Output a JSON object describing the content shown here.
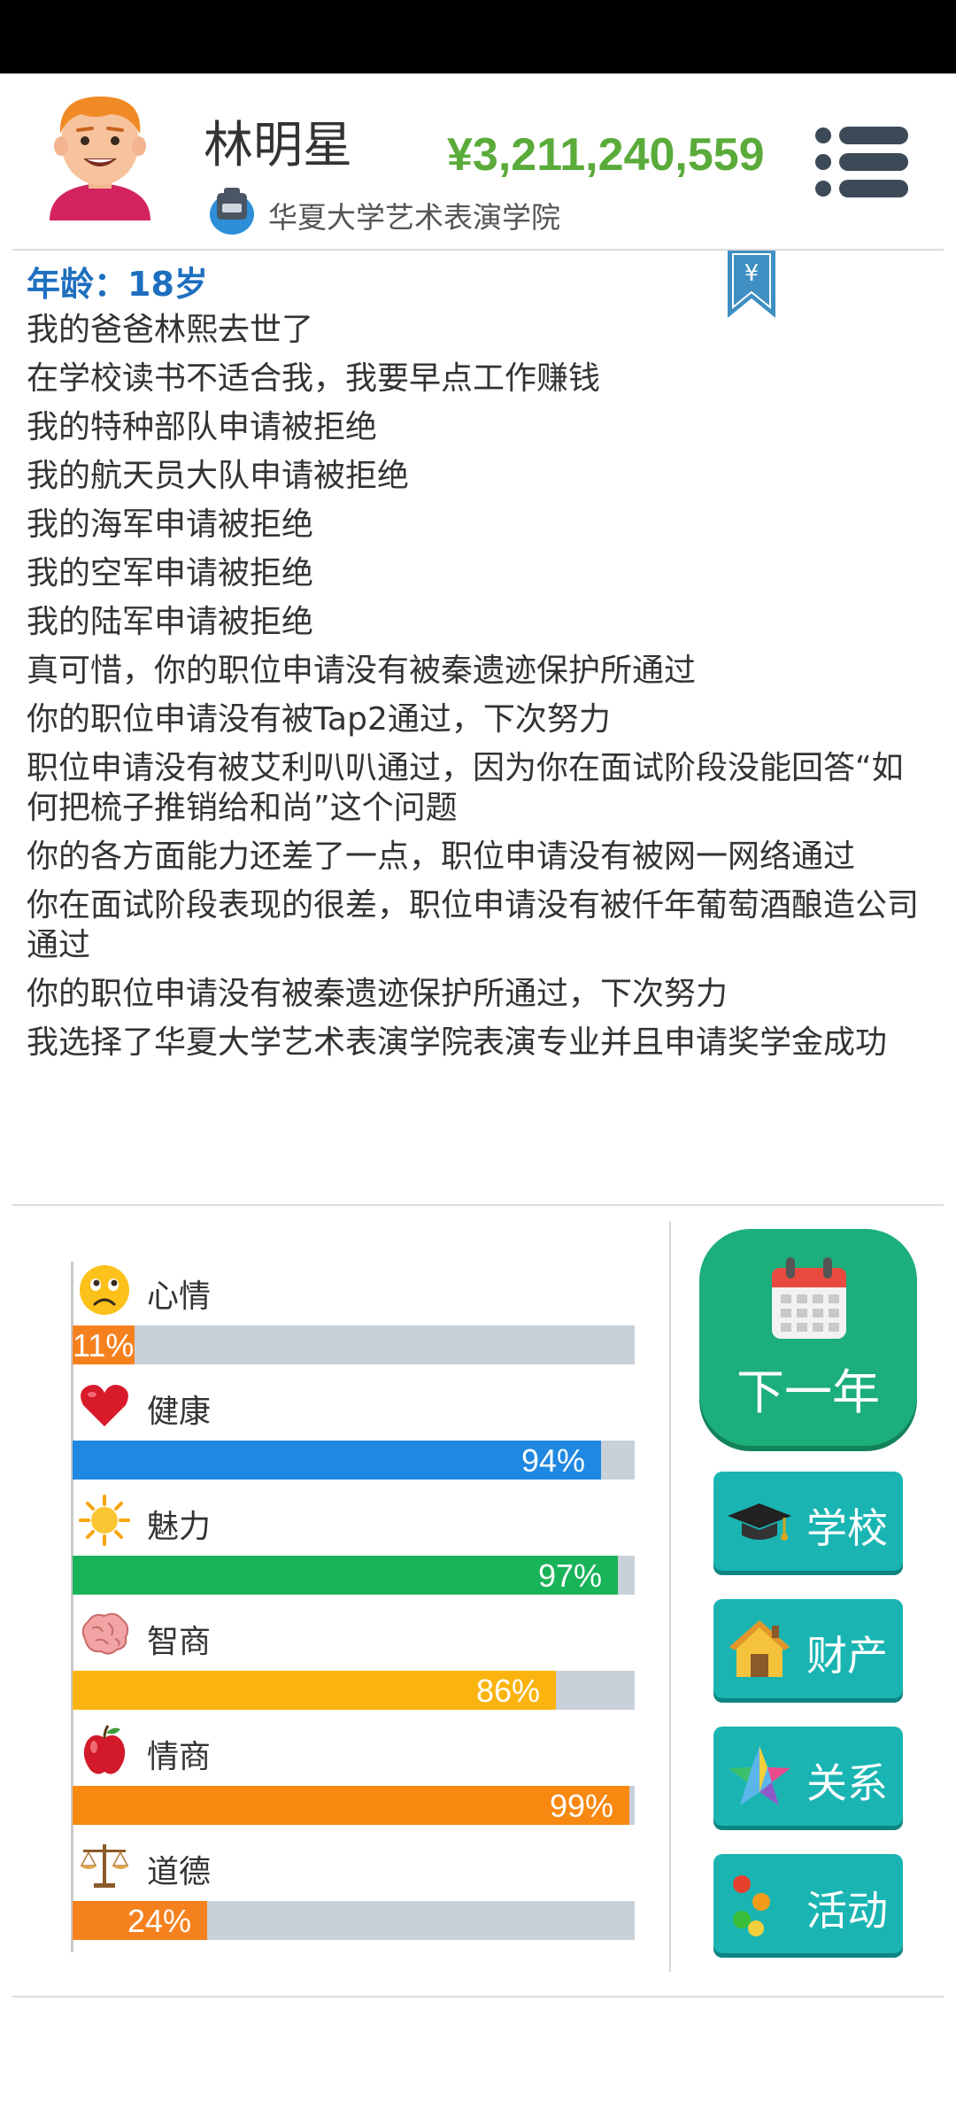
{
  "profile": {
    "name": "林明星",
    "money": "¥3,211,240,559",
    "school": "华夏大学艺术表演学院"
  },
  "log": {
    "age_line": "年龄：18岁",
    "bookmark_symbol": "¥",
    "entries": [
      "我的爸爸林熙去世了",
      "在学校读书不适合我，我要早点工作赚钱",
      "我的特种部队申请被拒绝",
      "我的航天员大队申请被拒绝",
      "我的海军申请被拒绝",
      "我的空军申请被拒绝",
      "我的陆军申请被拒绝",
      "真可惜，你的职位申请没有被秦遗迹保护所通过",
      "你的职位申请没有被Tap2通过，下次努力",
      "职位申请没有被艾利叭叭通过，因为你在面试阶段没能回答“如何把梳子推销给和尚”这个问题",
      "你的各方面能力还差了一点，职位申请没有被网一网络通过",
      "你在面试阶段表现的很差，职位申请没有被仟年葡萄酒酿造公司通过",
      "你的职位申请没有被秦遗迹保护所通过，下次努力",
      "我选择了华夏大学艺术表演学院表演专业并且申请奖学金成功"
    ]
  },
  "stats": [
    {
      "key": "mood",
      "label": "心情",
      "value": 11,
      "display": "11%",
      "color": "#f5811e",
      "icon": "sad-face-icon"
    },
    {
      "key": "health",
      "label": "健康",
      "value": 94,
      "display": "94%",
      "color": "#1f88e0",
      "icon": "heart-icon"
    },
    {
      "key": "charm",
      "label": "魅力",
      "value": 97,
      "display": "97%",
      "color": "#19b35a",
      "icon": "sun-icon"
    },
    {
      "key": "iq",
      "label": "智商",
      "value": 86,
      "display": "86%",
      "color": "#fbb40f",
      "icon": "brain-icon"
    },
    {
      "key": "eq",
      "label": "情商",
      "value": 99,
      "display": "99%",
      "color": "#f78810",
      "icon": "apple-icon"
    },
    {
      "key": "morality",
      "label": "道德",
      "value": 24,
      "display": "24%",
      "color": "#f5811e",
      "icon": "scale-icon"
    }
  ],
  "actions": {
    "next_year": "下一年",
    "school": "学校",
    "property": "财产",
    "relationship": "关系",
    "activity": "活动"
  },
  "colors": {
    "money": "#5aab3a",
    "age": "#1e6fbf",
    "next_year_bg": "#1cae7b",
    "side_button_bg": "#1ab5b3",
    "track": "#c8d0d9"
  }
}
